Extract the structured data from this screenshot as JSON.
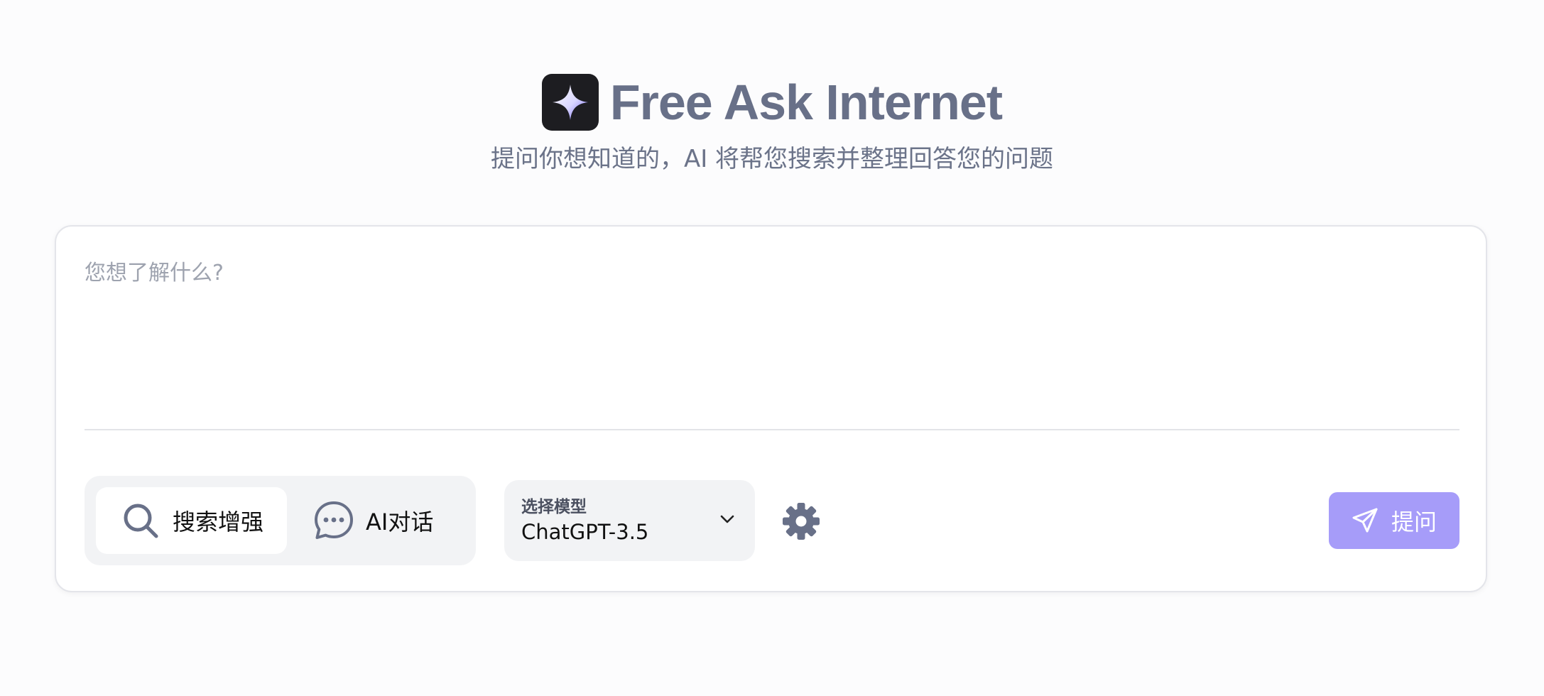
{
  "header": {
    "title": "Free Ask Internet",
    "subtitle": "提问你想知道的，AI 将帮您搜索并整理回答您的问题",
    "logo_icon": "sparkle-icon"
  },
  "question": {
    "value": "",
    "placeholder": "您想了解什么?"
  },
  "modes": {
    "search": {
      "label": "搜索增强",
      "icon": "search-icon",
      "selected": true
    },
    "chat": {
      "label": "AI对话",
      "icon": "chat-bubble-icon",
      "selected": false
    }
  },
  "model_select": {
    "caption": "选择模型",
    "value": "ChatGPT-3.5",
    "icon": "chevron-down-icon"
  },
  "settings": {
    "icon": "gear-icon"
  },
  "submit": {
    "label": "提问",
    "icon": "send-icon"
  },
  "colors": {
    "title": "#687088",
    "accent": "#a69cf9",
    "icon_gray": "#687088",
    "panel_bg": "#f2f3f5"
  }
}
